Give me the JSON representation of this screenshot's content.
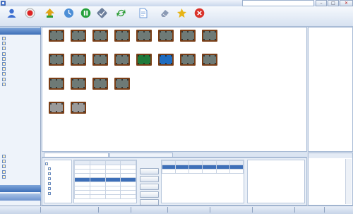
{
  "window": {
    "title": "",
    "user_text": "",
    "min_glyph": "–",
    "max_glyph": "□",
    "close_glyph": "✕"
  },
  "toolbar": [
    {
      "label": "",
      "icon": "user-icon",
      "color": "#3d6fd0"
    },
    {
      "label": "",
      "icon": "record-icon",
      "color": "#d22"
    },
    {
      "label": "",
      "icon": "open-table-icon",
      "color": "#e0a316"
    },
    {
      "label": "",
      "icon": "clock-icon",
      "color": "#4c8ed6"
    },
    {
      "label": "",
      "icon": "pause-icon",
      "color": "#23a03a"
    },
    {
      "label": "",
      "icon": "check-icon",
      "color": "#6d7f9c"
    },
    {
      "label": "",
      "icon": "refresh-icon",
      "color": "#2b9c33"
    },
    {
      "label": "",
      "icon": "document-icon",
      "color": "#6d9ad8"
    },
    {
      "label": "",
      "icon": "eraser-icon",
      "color": "#8c9bb5"
    },
    {
      "label": "",
      "icon": "star-icon",
      "color": "#e7b416"
    },
    {
      "label": "",
      "icon": "exit-icon",
      "color": "#d9332b"
    }
  ],
  "sidebar": {
    "header": "",
    "items": [
      "",
      "",
      "",
      "",
      "",
      "",
      "",
      "",
      "",
      ""
    ],
    "lower_items": [
      "",
      "",
      "",
      "",
      ""
    ],
    "section1": "",
    "section2": ""
  },
  "tables": [
    {
      "label": "",
      "felt": "#6e7a76"
    },
    {
      "label": "",
      "felt": "#6e7a76"
    },
    {
      "label": "",
      "felt": "#6e7a76"
    },
    {
      "label": "",
      "felt": "#6e7a76"
    },
    {
      "label": "",
      "felt": "#6e7a76"
    },
    {
      "label": "",
      "felt": "#6e7a76"
    },
    {
      "label": "",
      "felt": "#6e7a76"
    },
    {
      "label": "",
      "felt": "#6e7a76"
    },
    {
      "label": "",
      "felt": "#6e7a76"
    },
    {
      "label": "",
      "felt": "#6e7a76"
    },
    {
      "label": "",
      "felt": "#6e7a76"
    },
    {
      "label": "",
      "felt": "#6e7a76"
    },
    {
      "label": "",
      "felt": "#1f7a3b"
    },
    {
      "label": "",
      "felt": "#1f6cc0"
    },
    {
      "label": "",
      "felt": "#6e7a76"
    },
    {
      "label": "",
      "felt": "#6e7a76"
    },
    {
      "label": "",
      "felt": "#6e7a76"
    },
    {
      "label": "",
      "felt": "#6e7a76"
    },
    {
      "label": "",
      "felt": "#6e7a76"
    },
    {
      "label": "",
      "felt": "#6e7a76"
    },
    {
      "label": "",
      "felt": "#9a9a9a"
    },
    {
      "label": "",
      "felt": "#9a9a9a"
    }
  ],
  "info": {
    "title": "",
    "title_value": "",
    "rows": [
      "",
      "",
      "",
      "",
      "",
      "",
      "",
      "",
      "",
      "",
      "",
      ""
    ]
  },
  "bottom": {
    "tab1": "",
    "tab2": "",
    "tree": [
      "",
      "",
      "",
      "",
      "",
      "",
      ""
    ],
    "menu_headers": [
      "",
      "",
      "",
      ""
    ],
    "menu_rows": [
      [
        "",
        "",
        "",
        ""
      ],
      [
        "",
        "",
        "",
        ""
      ],
      [
        "",
        "",
        "",
        ""
      ],
      [
        "",
        "",
        "",
        ""
      ],
      [
        "",
        "",
        "",
        ""
      ],
      [
        "",
        "",
        "",
        ""
      ],
      [
        "",
        "",
        "",
        ""
      ],
      [
        "",
        "",
        "",
        ""
      ]
    ],
    "buttons": [
      "",
      "",
      "",
      "",
      ""
    ],
    "order_headers": [
      "",
      "",
      "",
      "",
      "",
      ""
    ],
    "order_rows": [
      [
        "",
        "",
        "",
        "",
        "",
        ""
      ],
      [
        "",
        "",
        "",
        "",
        "",
        ""
      ]
    ],
    "note_header": ""
  },
  "status": [
    "",
    "",
    "",
    "",
    "",
    "",
    "",
    "",
    ""
  ]
}
